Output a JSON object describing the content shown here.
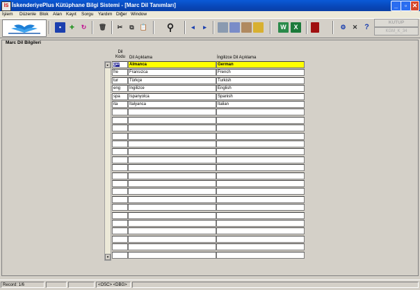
{
  "window": {
    "title": "İskenderiyePlus Kütüphane Bilgi Sistemi - [Marc Dil Tanımları]",
    "app_icon_text": "İS",
    "controls": [
      "_",
      "▫",
      "✕"
    ]
  },
  "menu": [
    "İşlem",
    "Düzenle",
    "Blok",
    "Alan",
    "Kayıt",
    "Sorgu",
    "Yardım",
    "Diğer",
    "Window"
  ],
  "toolbar": {
    "kutup_label": "KUTUP",
    "kgm_label": "KGM_K_34"
  },
  "form": {
    "section_title": "Marc Dil Bilgileri",
    "columns": {
      "code": "Dil\nKodu",
      "desc": "Dil Açıklama",
      "eng": "İngilizce Dil Açıklama"
    },
    "rows": [
      {
        "code": "ger",
        "desc": "Almanca",
        "eng": "German",
        "selected": true
      },
      {
        "code": "fre",
        "desc": "Fransızca",
        "eng": "French"
      },
      {
        "code": "tur",
        "desc": "Türkçe",
        "eng": "Turkish"
      },
      {
        "code": "eng",
        "desc": "İngilizce",
        "eng": "English"
      },
      {
        "code": "spa",
        "desc": "İspanyolca",
        "eng": "Spanish"
      },
      {
        "code": "ita",
        "desc": "İtalyanca",
        "eng": "Italian"
      }
    ],
    "empty_rows": 19
  },
  "status": {
    "record": "Record: 1/6",
    "osc": "<OSC> <DBG>"
  },
  "colors": {
    "title_bar": "#0847b8",
    "selected_row": "#ffff00",
    "window_bg": "#d4d0c8"
  }
}
